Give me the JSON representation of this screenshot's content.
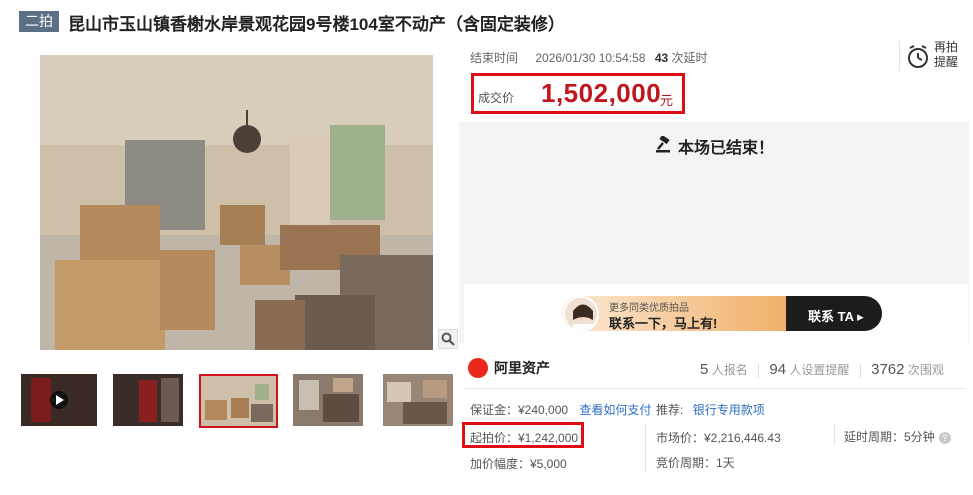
{
  "header": {
    "badge": "二拍",
    "title": "昆山市玉山镇香榭水岸景观花园9号楼104室不动产（含固定装修）"
  },
  "auction": {
    "end_label": "结束时间",
    "end_time": "2026/01/30 10:54:58",
    "delay_count": "43",
    "delay_label": "次延时",
    "remind_line1": "再拍",
    "remind_line2": "提醒",
    "deal_label": "成交价",
    "deal_price": "1,502,000",
    "deal_unit": "元",
    "status": "本场已结束！"
  },
  "banner": {
    "line1": "更多同类优质拍品",
    "line2": "联系一下，马上有!",
    "cta": "联系 TA"
  },
  "platform": {
    "name": "阿里资产"
  },
  "stats": {
    "signup_count": "5",
    "signup_label": "人报名",
    "remind_count": "94",
    "remind_label": "人设置提醒",
    "view_count": "3762",
    "view_label": "次围观"
  },
  "details": {
    "deposit": "保证金：¥240,000",
    "pay_link": "查看如何支付",
    "recommend_label": "推荐:",
    "bank_link": "银行专用款项",
    "start_price": "起拍价：¥1,242,000",
    "market_price": "市场价：¥2,216,446.43",
    "delay_period": "延时周期：5分钟",
    "increment": "加价幅度：¥5,000",
    "bid_period": "竞价周期：1天"
  },
  "colors": {
    "accent": "#c0171e",
    "highlight_border": "#e00c14",
    "link": "#2f6fc1"
  },
  "icons": [
    "gavel-icon",
    "alarm-clock-icon",
    "zoom-icon",
    "play-icon",
    "help-icon"
  ]
}
